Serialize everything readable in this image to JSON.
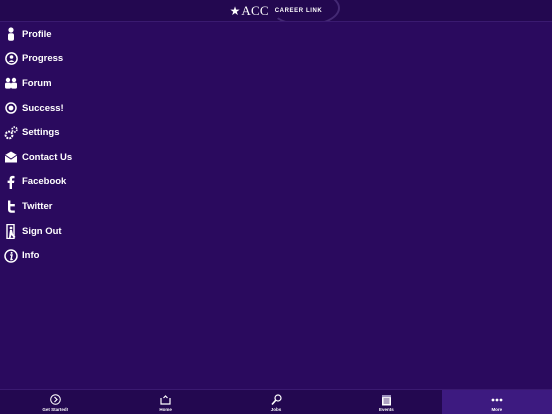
{
  "header": {
    "logo_text": "ACC",
    "logo_subtitle": "CAREER LINK"
  },
  "menu": {
    "items": [
      {
        "label": "Profile",
        "icon": "person-icon"
      },
      {
        "label": "Progress",
        "icon": "progress-icon"
      },
      {
        "label": "Forum",
        "icon": "people-icon"
      },
      {
        "label": "Success!",
        "icon": "success-icon"
      },
      {
        "label": "Settings",
        "icon": "gears-icon"
      },
      {
        "label": "Contact Us",
        "icon": "envelope-icon"
      },
      {
        "label": "Facebook",
        "icon": "facebook-icon"
      },
      {
        "label": "Twitter",
        "icon": "twitter-icon"
      },
      {
        "label": "Sign Out",
        "icon": "sign-out-icon"
      },
      {
        "label": "Info",
        "icon": "info-icon"
      }
    ]
  },
  "tabbar": {
    "tabs": [
      {
        "label": "Get Started!",
        "icon": "chevron-circle-icon"
      },
      {
        "label": "Home",
        "icon": "home-icon"
      },
      {
        "label": "Jobs",
        "icon": "magnifier-icon"
      },
      {
        "label": "Events",
        "icon": "calendar-icon"
      },
      {
        "label": "More",
        "icon": "more-dots-icon",
        "active": true
      }
    ]
  },
  "colors": {
    "background": "#2a0a5e",
    "bar": "#230850",
    "active_tab": "#3d1a80",
    "text": "#ffffff"
  }
}
